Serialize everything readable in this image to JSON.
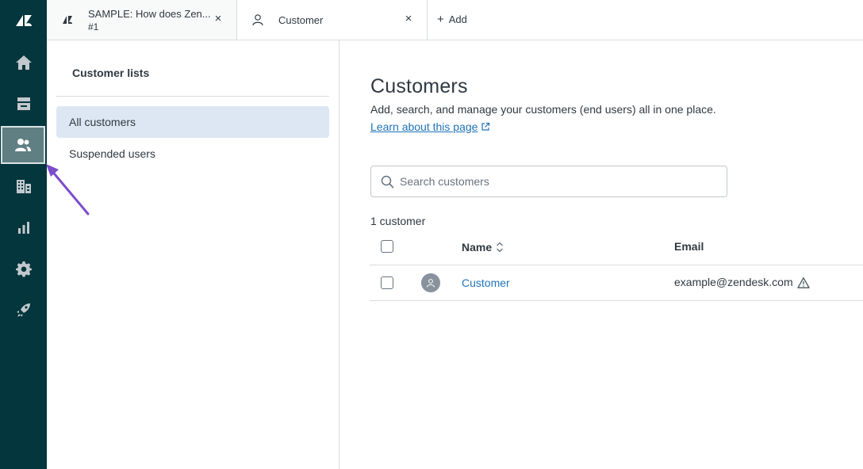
{
  "nav_rail": {
    "items": [
      {
        "icon": "zendesk-logo-icon"
      },
      {
        "icon": "home-icon"
      },
      {
        "icon": "views-icon"
      },
      {
        "icon": "customers-icon",
        "active": true
      },
      {
        "icon": "organizations-icon"
      },
      {
        "icon": "reporting-icon"
      },
      {
        "icon": "admin-gear-icon"
      },
      {
        "icon": "rocket-icon"
      }
    ],
    "colors": {
      "background": "#03363d",
      "active_bg": "#5f7f83"
    }
  },
  "tabs": [
    {
      "title": "SAMPLE: How does Zen...",
      "subtitle": "#1",
      "icon": "ticket-icon",
      "close": "×"
    },
    {
      "title": "Customer",
      "icon": "user-icon",
      "close": "×"
    }
  ],
  "add_tab": {
    "plus": "+",
    "label": "Add"
  },
  "customer_lists": {
    "heading": "Customer lists",
    "items": [
      {
        "label": "All customers",
        "active": true
      },
      {
        "label": "Suspended users"
      }
    ]
  },
  "main": {
    "title": "Customers",
    "description": "Add, search, and manage your customers (end users) all in one place.",
    "learn_link": "Learn about this page",
    "search": {
      "placeholder": "Search customers",
      "value": ""
    },
    "count": "1 customer",
    "table": {
      "columns": {
        "name": "Name",
        "email": "Email"
      },
      "rows": [
        {
          "name": "Customer",
          "email": "example@zendesk.com",
          "email_status_icon": "warning-icon"
        }
      ]
    },
    "colors": {
      "link": "#1f73b7",
      "selected_list": "#dce7f3"
    }
  },
  "annotation": {
    "type": "arrow",
    "color": "#7c4dcc"
  }
}
